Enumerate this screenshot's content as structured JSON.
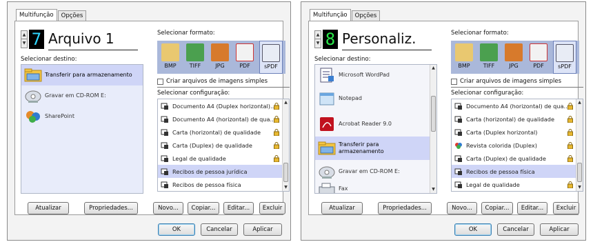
{
  "left": {
    "tabs": [
      "Multifunção",
      "Opções"
    ],
    "config_number": "7",
    "config_name": "Arquivo 1",
    "select_destination_label": "Selecionar destino:",
    "destinations": [
      {
        "label": "Transferir para armazenamento",
        "icon": "folder-icon",
        "selected": true
      },
      {
        "label": "Gravar em CD-ROM  E:",
        "icon": "cd-rom-icon",
        "selected": false
      },
      {
        "label": "SharePoint",
        "icon": "sharepoint-icon",
        "selected": false
      }
    ],
    "select_format_label": "Selecionar formato:",
    "formats": [
      "BMP",
      "TIFF",
      "JPG",
      "PDF",
      "sPDF"
    ],
    "selected_format": "sPDF",
    "simple_images_checkbox": "Criar arquivos de imagens simples",
    "select_config_label": "Selecionar configuração:",
    "configs": [
      {
        "label": "Documento A4 (Duplex horizontal)...",
        "locked": true,
        "selected": false
      },
      {
        "label": "Documento A4 (horizontal) de qua...",
        "locked": true,
        "selected": false
      },
      {
        "label": "Carta (horizontal) de qualidade",
        "locked": true,
        "selected": false
      },
      {
        "label": "Carta (Duplex) de qualidade",
        "locked": true,
        "selected": false
      },
      {
        "label": "Legal de qualidade",
        "locked": true,
        "selected": false
      },
      {
        "label": "Recibos de pessoa jurídica",
        "locked": false,
        "selected": true
      },
      {
        "label": "Recibos de pessoa física",
        "locked": false,
        "selected": false
      }
    ],
    "buttons": {
      "update": "Atualizar",
      "properties": "Propriedades...",
      "new": "Novo...",
      "copy": "Copiar...",
      "edit": "Editar...",
      "delete": "Excluir",
      "ok": "OK",
      "cancel": "Cancelar",
      "apply": "Aplicar"
    }
  },
  "right": {
    "tabs": [
      "Multifunção",
      "Opções"
    ],
    "config_number": "8",
    "config_name": "Personaliz.",
    "select_destination_label": "Selecionar destino:",
    "destinations": [
      {
        "label": "Microsoft WordPad",
        "icon": "wordpad-icon",
        "selected": false
      },
      {
        "label": "Notepad",
        "icon": "notepad-icon",
        "selected": false
      },
      {
        "label": "Acrobat Reader 9.0",
        "icon": "acrobat-icon",
        "selected": false
      },
      {
        "label": "Transferir para armazenamento",
        "icon": "folder-icon",
        "selected": true
      },
      {
        "label": "Gravar em CD-ROM  E:",
        "icon": "cd-rom-icon",
        "selected": false
      },
      {
        "label": "Fax",
        "icon": "fax-icon",
        "selected": false
      }
    ],
    "select_format_label": "Selecionar formato:",
    "formats": [
      "BMP",
      "TIFF",
      "JPG",
      "PDF",
      "sPDF"
    ],
    "selected_format": "sPDF",
    "simple_images_checkbox": "Criar arquivos de imagens simples",
    "select_config_label": "Selecionar configuração:",
    "configs": [
      {
        "label": "Documento A4 (horizontal) de qua...",
        "locked": true,
        "selected": false
      },
      {
        "label": "Carta (horizontal) de qualidade",
        "locked": true,
        "selected": false
      },
      {
        "label": "Carta (Duplex horizontal)",
        "locked": true,
        "selected": false
      },
      {
        "label": "Revista colorida (Duplex)",
        "locked": true,
        "selected": false
      },
      {
        "label": "Carta (Duplex) de qualidade",
        "locked": true,
        "selected": false
      },
      {
        "label": "Recibos de pessoa física",
        "locked": false,
        "selected": true
      },
      {
        "label": "Legal de qualidade",
        "locked": true,
        "selected": false
      }
    ],
    "buttons": {
      "update": "Atualizar",
      "properties": "Propriedades...",
      "new": "Novo...",
      "copy": "Copiar...",
      "edit": "Editar...",
      "delete": "Excluir",
      "ok": "OK",
      "cancel": "Cancelar",
      "apply": "Aplicar"
    }
  }
}
